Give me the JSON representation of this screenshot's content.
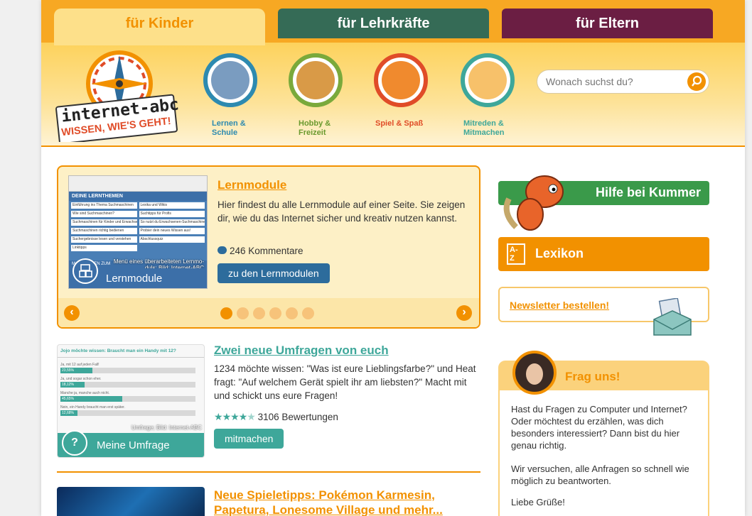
{
  "tabs": [
    "für Kinder",
    "für Lehrkräfte",
    "für Eltern"
  ],
  "logo": {
    "line1": "internet-abc",
    "line2": "WISSEN, WIE'S GEHT!"
  },
  "categories": [
    {
      "label": "Lernen &\nSchule",
      "color": "#2d8ab0"
    },
    {
      "label": "Hobby &\nFreizeit",
      "color": "#7aa93b"
    },
    {
      "label": "Spiel & Spaß",
      "color": "#e04c28"
    },
    {
      "label": "Mitreden &\nMitmachen",
      "color": "#3ea79a"
    }
  ],
  "search": {
    "placeholder": "Wonach suchst du?"
  },
  "feature": {
    "title": "Lernmodule",
    "text": "Hier findest du alle Lernmodule auf einer Seite. Sie zeigen dir, wie du das Internet sicher und kreativ nutzen kannst.",
    "comments": "246 Kommentare",
    "button": "zu den Lernmodulen",
    "thumb_label": "Lernmodule",
    "thumb_caption": "Menü eines überarbeiteten Lernmo-\nduls; Bild: Internet-ABC",
    "thumb_heading": "DEINE LERNTHEMEN",
    "thumb_items": [
      "Einführung ins Thema Suchmaschinen",
      "Wie sind Suchmaschinen?",
      "Suchmaschinen für Kinder und Erwachsene",
      "Suchmaschinen richtig bedienen",
      "Suchergebnisse lesen und verstehen",
      "Linktipps",
      "Lexika und Wikis",
      "Suchtipps für Profis",
      "So nutzt du Erwachsenen-Suchmaschinen",
      "Probier dein neues Wissen aus!",
      "Abschlussquiz"
    ],
    "thumb_small": "MATERIALIEN ZUM"
  },
  "article1": {
    "title": "Zwei neue Umfragen von euch",
    "text": "1234 möchte wissen: \"Was ist eure Lieblingsfarbe?\" und Heat fragt: \"Auf welchem Gerät spielt ihr am liebsten?\" Macht mit und schickt uns eure Fragen!",
    "ratings": "3106 Bewertungen",
    "rating_value": 4,
    "button": "mitmachen",
    "thumb_label": "Meine Umfrage",
    "thumb_caption": "Umfrage; Bild: Internet-ABC",
    "thumb_heading": "Jojo möchte wissen: Braucht man ein Handy mit 12?",
    "bars": [
      {
        "label": "Ja, mit 12 auf jeden Fall!",
        "value": "23,55%",
        "frac": 0.2355
      },
      {
        "label": "Ja, und sogar schon eher.",
        "value": "18,12%",
        "frac": 0.1812
      },
      {
        "label": "Manche ja, manche auch nicht.",
        "value": "45,65%",
        "frac": 0.4565
      },
      {
        "label": "Nein, ein Handy braucht man erst später.",
        "value": "12,68%",
        "frac": 0.1268
      }
    ]
  },
  "article2": {
    "title": "Neue Spieletipps: Pokémon Karmesin, Papetura, Lonesome Village und mehr..."
  },
  "sidebar": {
    "kummer": "Hilfe bei Kummer",
    "lexikon": "Lexikon",
    "lexikon_icon": "A-Z",
    "newsletter": "Newsletter bestellen!",
    "frag_title": "Frag uns!",
    "frag_p1": "Hast du Fragen zu Computer und Internet? Oder möchtest du erzählen, was dich besonders interessiert? Dann bist du hier genau richtig.",
    "frag_p2": "Wir versuchen, alle Anfragen so schnell wie möglich zu beantworten.",
    "frag_p3": "Liebe Grüße!"
  },
  "colors": {
    "orange": "#f29100",
    "teal": "#3ea79a",
    "blue": "#2d6c9c",
    "green": "#3a9a4a"
  }
}
